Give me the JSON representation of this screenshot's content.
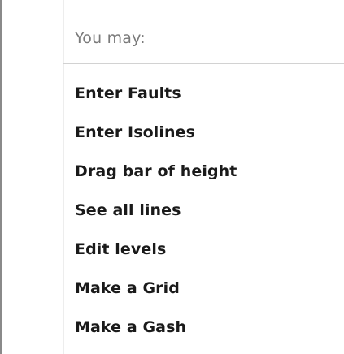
{
  "menu": {
    "header": "You may:",
    "items": [
      {
        "id": "enter-faults",
        "label": "Enter Faults"
      },
      {
        "id": "enter-isolines",
        "label": "Enter Isolines"
      },
      {
        "id": "drag-bar-of-height",
        "label": "Drag bar of height"
      },
      {
        "id": "see-all-lines",
        "label": "See all lines"
      },
      {
        "id": "edit-levels",
        "label": "Edit levels"
      },
      {
        "id": "make-a-grid",
        "label": "Make a Grid"
      },
      {
        "id": "make-a-gash",
        "label": "Make a Gash"
      }
    ]
  },
  "colors": {
    "background": "#ffffff",
    "header_text": "#7a7a7a",
    "item_text": "#1a1a1a",
    "separator": "#d2d2d2",
    "left_border": "#8a8a8a"
  }
}
